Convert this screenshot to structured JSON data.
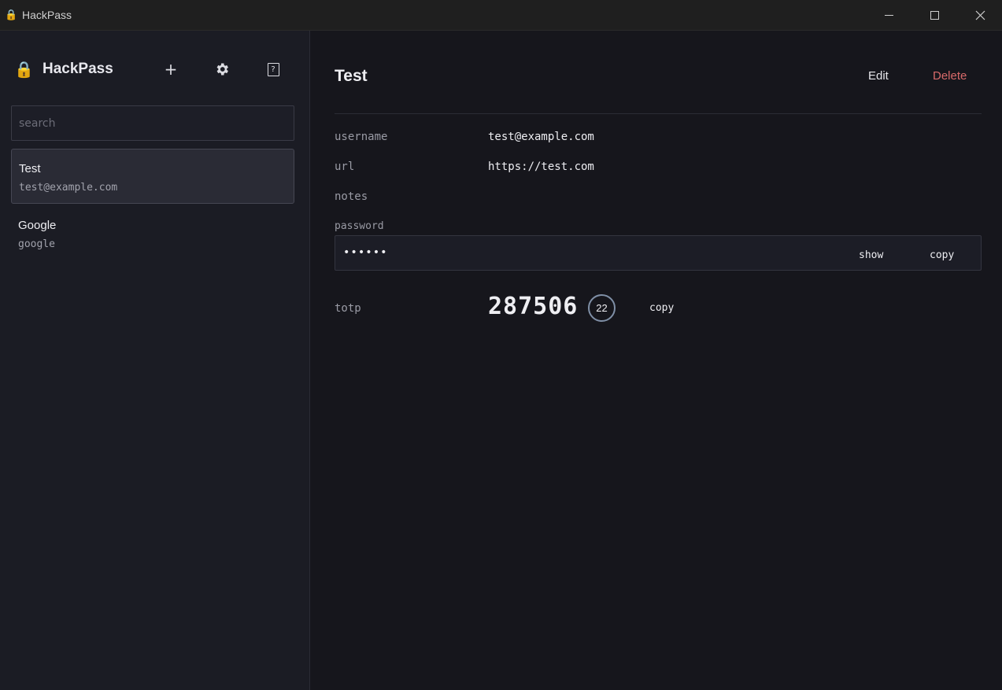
{
  "window": {
    "title": "HackPass",
    "icon": "lock-icon"
  },
  "sidebar": {
    "brand": "HackPass",
    "add_label": "+",
    "key_label": "?",
    "search_placeholder": "search",
    "search_value": "",
    "entries": [
      {
        "name": "Test",
        "subtitle": "test@example.com",
        "selected": true
      },
      {
        "name": "Google",
        "subtitle": "google",
        "selected": false
      }
    ]
  },
  "detail": {
    "title": "Test",
    "edit_label": "Edit",
    "delete_label": "Delete",
    "delete_color": "#d86a6a",
    "fields": {
      "username_label": "username",
      "username_value": "test@example.com",
      "url_label": "url",
      "url_value": "https://test.com",
      "notes_label": "notes",
      "notes_value": "",
      "password_label": "password",
      "password_masked": "••••••",
      "show_label": "show",
      "copy_label": "copy"
    },
    "totp": {
      "label": "totp",
      "code": "287506",
      "seconds_remaining": "22",
      "copy_label": "copy"
    }
  }
}
